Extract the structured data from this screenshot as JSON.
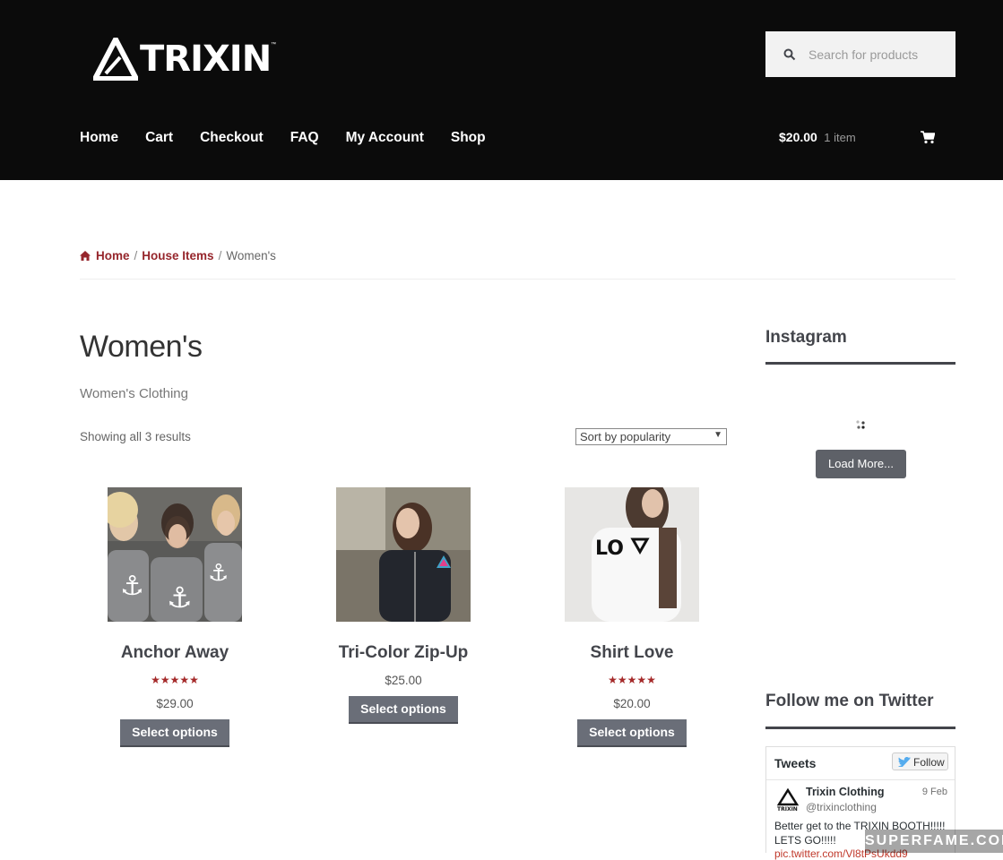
{
  "brand": {
    "name": "TRIXIN",
    "tm": "™"
  },
  "search": {
    "placeholder": "Search for products"
  },
  "nav": {
    "items": [
      "Home",
      "Cart",
      "Checkout",
      "FAQ",
      "My Account",
      "Shop"
    ]
  },
  "cart": {
    "amount": "$20.00",
    "count": "1 item"
  },
  "breadcrumb": {
    "home": "Home",
    "parent": "House Items",
    "sep": "/",
    "current": "Women's"
  },
  "page": {
    "title": "Women's",
    "description": "Women's Clothing",
    "results": "Showing all 3 results",
    "sort_selected": "Sort by popularity"
  },
  "products": [
    {
      "name": "Anchor Away",
      "stars": "★★★★★",
      "rating": 5,
      "price": "$29.00",
      "button": "Select options"
    },
    {
      "name": "Tri-Color Zip-Up",
      "stars": "",
      "rating": 0,
      "price": "$25.00",
      "button": "Select options"
    },
    {
      "name": "Shirt Love",
      "stars": "★★★★★",
      "rating": 5,
      "price": "$20.00",
      "button": "Select options"
    }
  ],
  "sidebar": {
    "instagram_title": "Instagram",
    "load_more": "Load More...",
    "twitter_title": "Follow me on Twitter"
  },
  "tweets": {
    "header": "Tweets",
    "follow": "Follow",
    "author": "Trixin Clothing",
    "handle": "@trixinclothing",
    "date": "9 Feb",
    "text": "Better get to the TRIXIN BOOTH!!!!! LETS GO!!!!!",
    "link": "pic.twitter.com/Vl8tPsUkdd9"
  },
  "watermark": "SUPERFAME.COM",
  "colors": {
    "header_bg": "#0b0b0b",
    "accent": "#96262c",
    "button": "#6a6e78"
  }
}
